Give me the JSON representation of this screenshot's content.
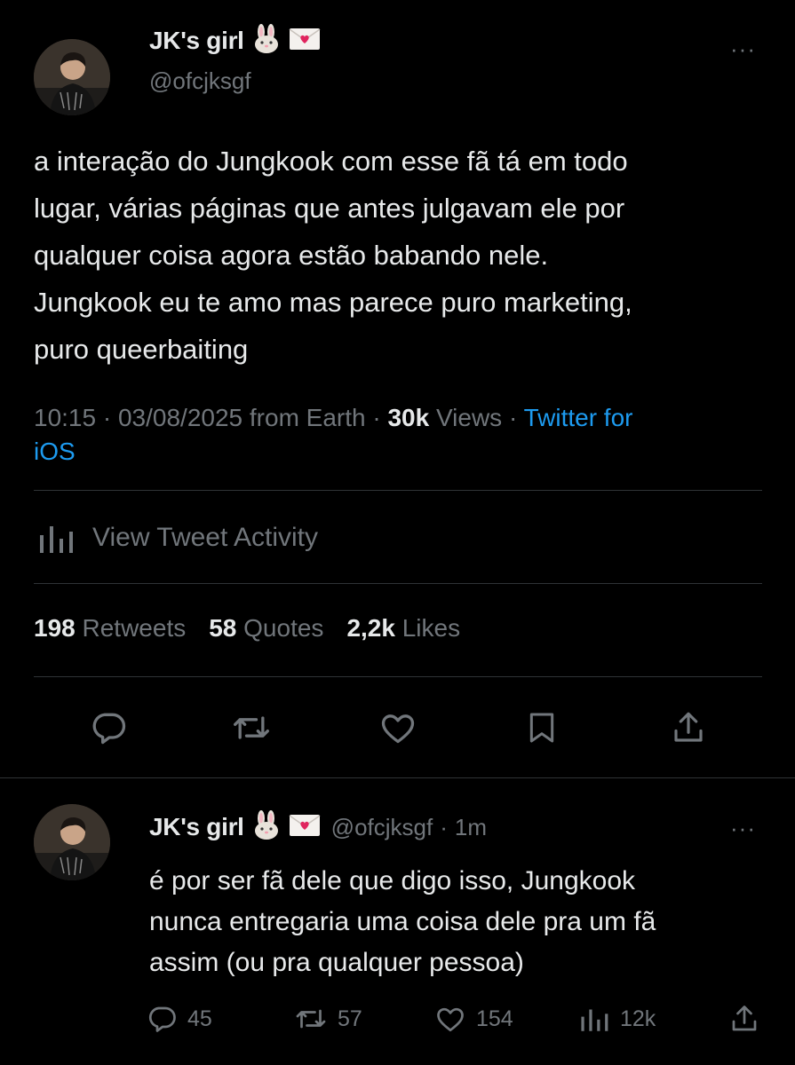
{
  "main_tweet": {
    "display_name": "JK's girl",
    "handle": "@ofcjksgf",
    "more_label": "···",
    "text_lines": [
      "a interação do Jungkook com esse fã tá em todo",
      "lugar, várias páginas que antes julgavam ele por",
      "qualquer coisa agora estão babando nele.",
      "Jungkook eu te amo mas parece puro marketing,",
      "puro queerbaiting"
    ],
    "time": "10:15",
    "date": "03/08/2025",
    "location": "from Earth",
    "views_count": "30k",
    "views_label": "Views",
    "source_line1": "Twitter for",
    "source_line2": "iOS",
    "separator": "·",
    "activity_label": "View Tweet Activity",
    "retweets_count": "198",
    "retweets_label": "Retweets",
    "quotes_count": "58",
    "quotes_label": "Quotes",
    "likes_count": "2,2k",
    "likes_label": "Likes",
    "actions": [
      "reply-icon",
      "retweet-icon",
      "like-icon",
      "bookmark-icon",
      "share-icon"
    ]
  },
  "reply_tweet": {
    "display_name": "JK's girl",
    "handle": "@ofcjksgf",
    "separator": "·",
    "time_ago": "1m",
    "more_label": "···",
    "text_lines": [
      "é por ser fã dele que digo isso, Jungkook",
      "nunca entregaria uma coisa dele pra um fã",
      "assim (ou pra qualquer pessoa)"
    ],
    "replies_count": "45",
    "retweets_count": "57",
    "likes_count": "154",
    "views_count": "12k"
  },
  "colors": {
    "background": "#000000",
    "text": "#e7e9ea",
    "secondary": "#71767b",
    "link": "#1d9bf0",
    "divider": "#2f3336"
  }
}
